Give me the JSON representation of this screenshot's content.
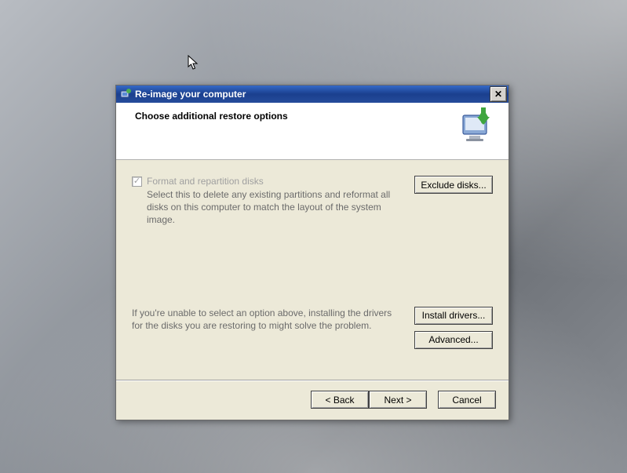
{
  "window": {
    "title": "Re-image your computer"
  },
  "header": {
    "title": "Choose additional restore options"
  },
  "options": {
    "format": {
      "label": "Format and repartition disks",
      "desc": "Select this to delete any existing partitions and reformat all disks on this computer to match the layout of the system image.",
      "checked": true,
      "disabled": true
    },
    "exclude_button": "Exclude disks...",
    "driver_hint": "If you're unable to select an option above, installing the drivers for the disks you are restoring to might solve the problem.",
    "install_button": "Install drivers...",
    "advanced_button": "Advanced..."
  },
  "footer": {
    "back": "< Back",
    "next": "Next >",
    "cancel": "Cancel"
  }
}
